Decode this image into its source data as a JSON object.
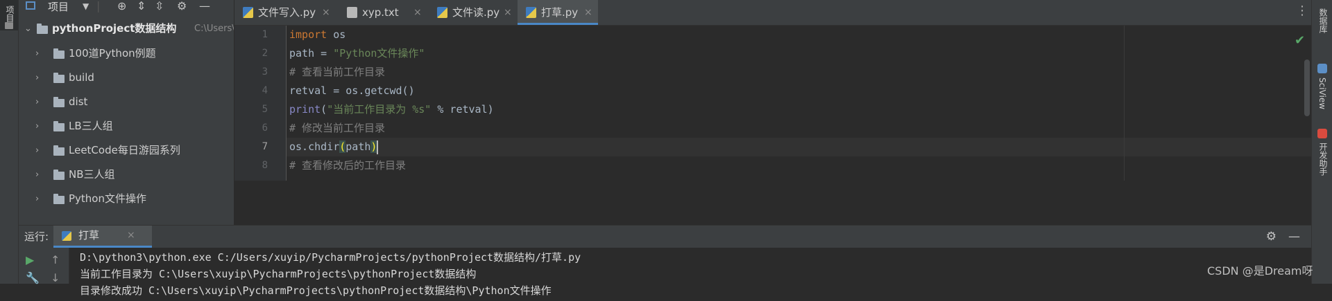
{
  "sidebar_left": {
    "tab_label": "项目"
  },
  "project": {
    "title": "项目",
    "root": {
      "name": "pythonProject数据结构",
      "path": "C:\\Users\\xu"
    },
    "items": [
      {
        "label": "100道Python例题"
      },
      {
        "label": "build"
      },
      {
        "label": "dist"
      },
      {
        "label": "LB三人组"
      },
      {
        "label": "LeetCode每日游园系列"
      },
      {
        "label": "NB三人组"
      },
      {
        "label": "Python文件操作"
      }
    ]
  },
  "tabs": [
    {
      "label": "文件写入.py",
      "icon": "python-file-icon"
    },
    {
      "label": "xyp.txt",
      "icon": "text-file-icon"
    },
    {
      "label": "文件读.py",
      "icon": "python-file-icon"
    },
    {
      "label": "打草.py",
      "icon": "python-file-icon",
      "active": true
    }
  ],
  "editor": {
    "current_line": 7,
    "line_numbers": [
      "1",
      "2",
      "3",
      "4",
      "5",
      "6",
      "7",
      "8"
    ],
    "lines": [
      "import os",
      "path = \"Python文件操作\"",
      "# 查看当前工作目录",
      "retval = os.getcwd()",
      "print(\"当前工作目录为 %s\" % retval)",
      "# 修改当前工作目录",
      "os.chdir(path)",
      "# 查看修改后的工作目录"
    ],
    "tokens": {
      "l1_kw": "import",
      "l1_rest": " os",
      "l2_a": "path = ",
      "l2_str": "\"Python文件操作\"",
      "l3_cm": "# 查看当前工作目录",
      "l4_a": "retval = os.getcwd()",
      "l5_bi": "print",
      "l5_p1": "(",
      "l5_str": "\"当前工作目录为 %s\"",
      "l5_rest": " % retval)",
      "l6_cm": "# 修改当前工作目录",
      "l7_a": "os.chdir",
      "l7_p1": "(",
      "l7_mid": "path",
      "l7_p2": ")",
      "l8_cm": "# 查看修改后的工作目录"
    }
  },
  "right_sidebar": [
    {
      "label": "数据库"
    },
    {
      "label": "SciView"
    },
    {
      "label": "开发助手"
    }
  ],
  "run_panel": {
    "label": "运行:",
    "tab_label": "打草",
    "output": [
      "D:\\python3\\python.exe C:/Users/xuyip/PycharmProjects/pythonProject数据结构/打草.py",
      "当前工作目录为 C:\\Users\\xuyip\\PycharmProjects\\pythonProject数据结构",
      "目录修改成功 C:\\Users\\xuyip\\PycharmProjects\\pythonProject数据结构\\Python文件操作"
    ]
  },
  "watermark": "CSDN @是Dream呀",
  "colors": {
    "background": "#2b2b2b",
    "panel": "#3c3f41",
    "keyword": "#cc7832",
    "string": "#6a8759",
    "comment": "#808080",
    "accent": "#4a88c7"
  }
}
